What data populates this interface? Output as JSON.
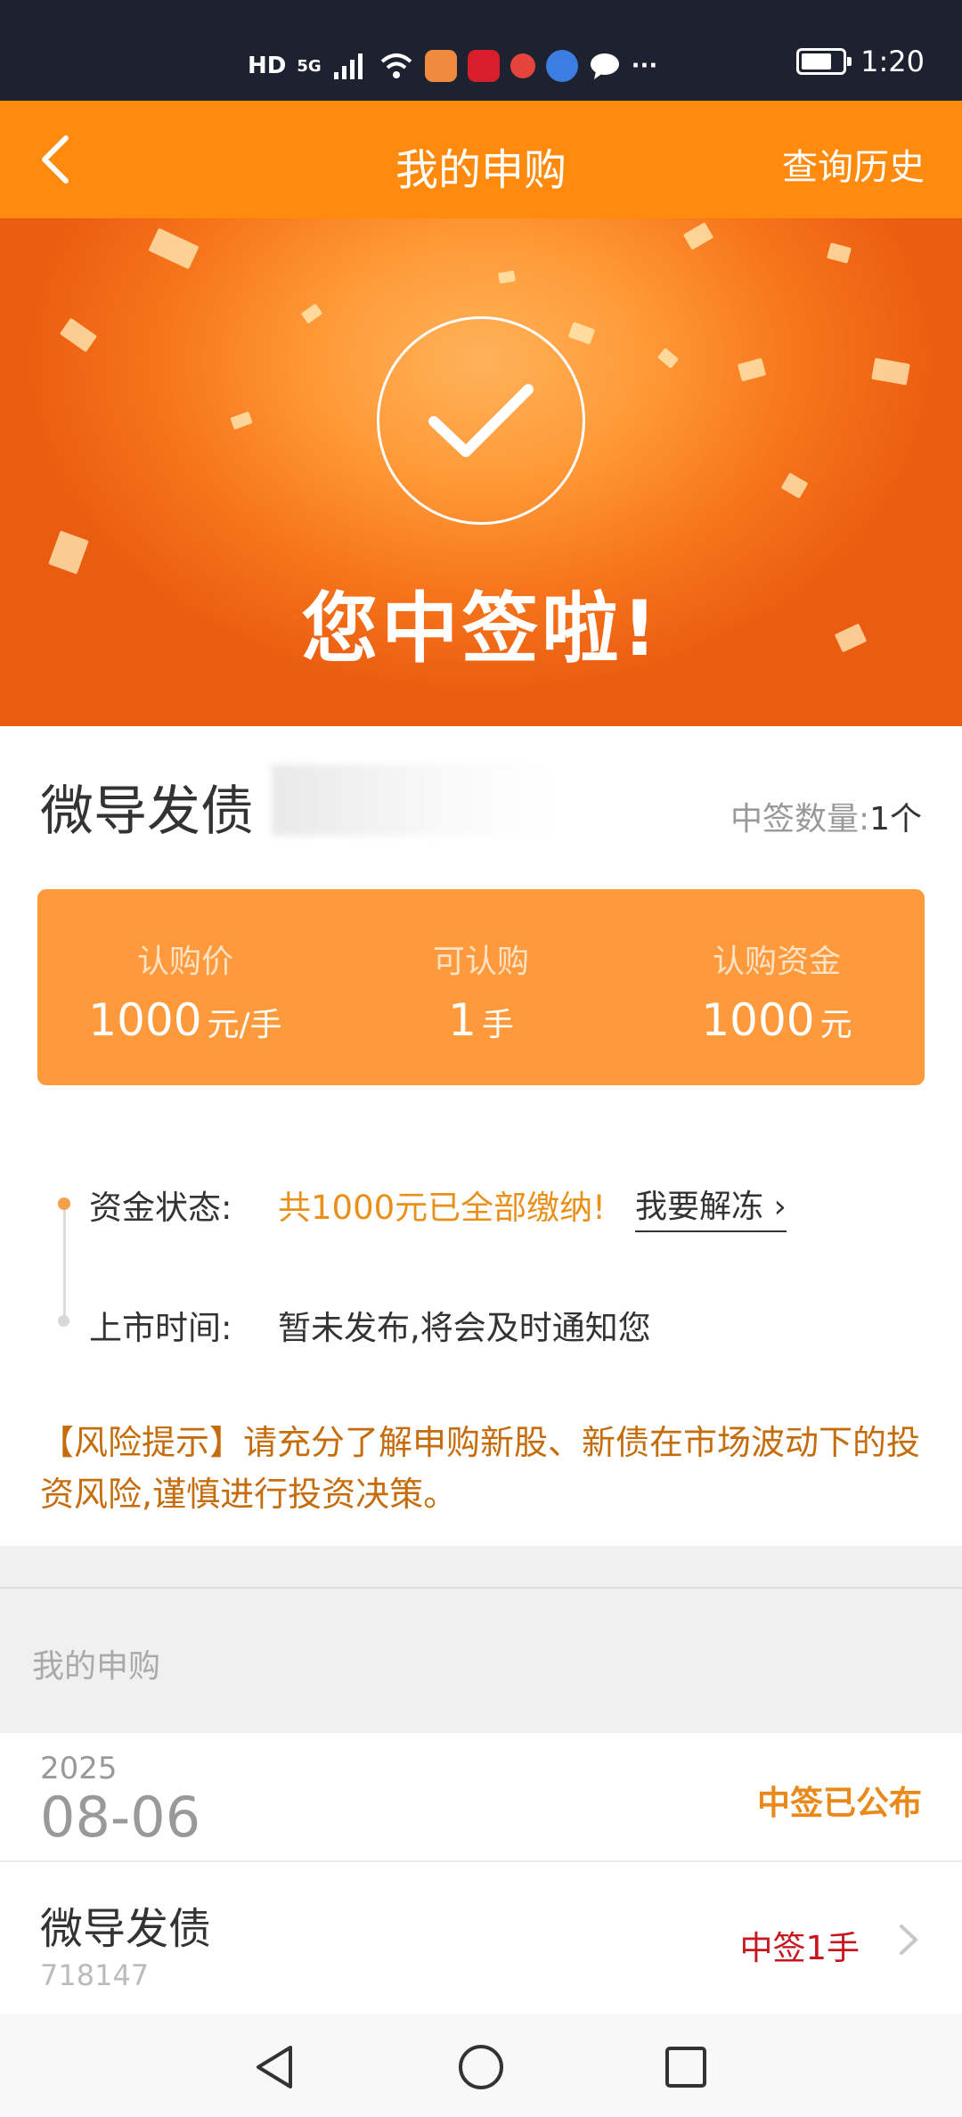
{
  "status_bar": {
    "network_label": "HD",
    "signal_label": "5G",
    "time": "1:20",
    "battery_level": 0.75,
    "more_label": "···"
  },
  "nav": {
    "title": "我的申购",
    "history_label": "查询历史"
  },
  "banner": {
    "message": "您中签啦!"
  },
  "bond": {
    "name": "微导发债",
    "win_count_label": "中签数量:",
    "win_count_value": "1个"
  },
  "info_card": {
    "price_label": "认购价",
    "price_value": "1000",
    "price_unit": "元/手",
    "available_label": "可认购",
    "available_value": "1",
    "available_unit": "手",
    "funds_label": "认购资金",
    "funds_value": "1000",
    "funds_unit": "元"
  },
  "fund_status": {
    "label": "资金状态:",
    "value": "共1000元已全部缴纳!",
    "link_label": "我要解冻 ›"
  },
  "listing": {
    "label": "上市时间:",
    "value": "暂未发布,将会及时通知您"
  },
  "risk_notice": "【风险提示】请充分了解申购新股、新债在市场波动下的投资风险,谨慎进行投资决策。",
  "section": {
    "title": "我的申购"
  },
  "record": {
    "year": "2025",
    "date": "08-06",
    "status": "中签已公布",
    "name": "微导发债",
    "code": "718147",
    "result": "中签1手"
  },
  "colors": {
    "accent": "#ff8a0e",
    "card": "#ff9a3c",
    "status_orange": "#e8901a",
    "win_red": "#c8161e"
  }
}
